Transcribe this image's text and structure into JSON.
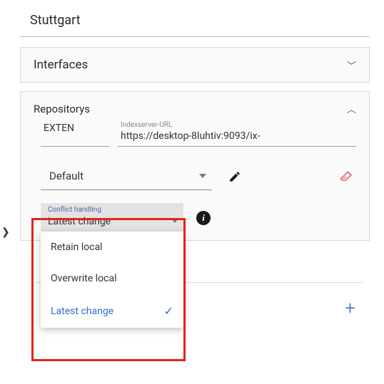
{
  "header": {
    "title": "Stuttgart"
  },
  "panels": {
    "interfaces": {
      "title": "Interfaces"
    },
    "repositorys": {
      "title": "Repositorys",
      "name_field": {
        "value": "EXTEN"
      },
      "url_field": {
        "label": "Indexserver-URL",
        "value": "https://desktop-8luhtiv:9093/ix-"
      },
      "profile_select": {
        "value": "Default"
      },
      "conflict": {
        "label": "Conflict handling",
        "value": "Latest change",
        "options": [
          "Retain local",
          "Overwrite local",
          "Latest change"
        ],
        "selected_index": 2
      }
    }
  }
}
